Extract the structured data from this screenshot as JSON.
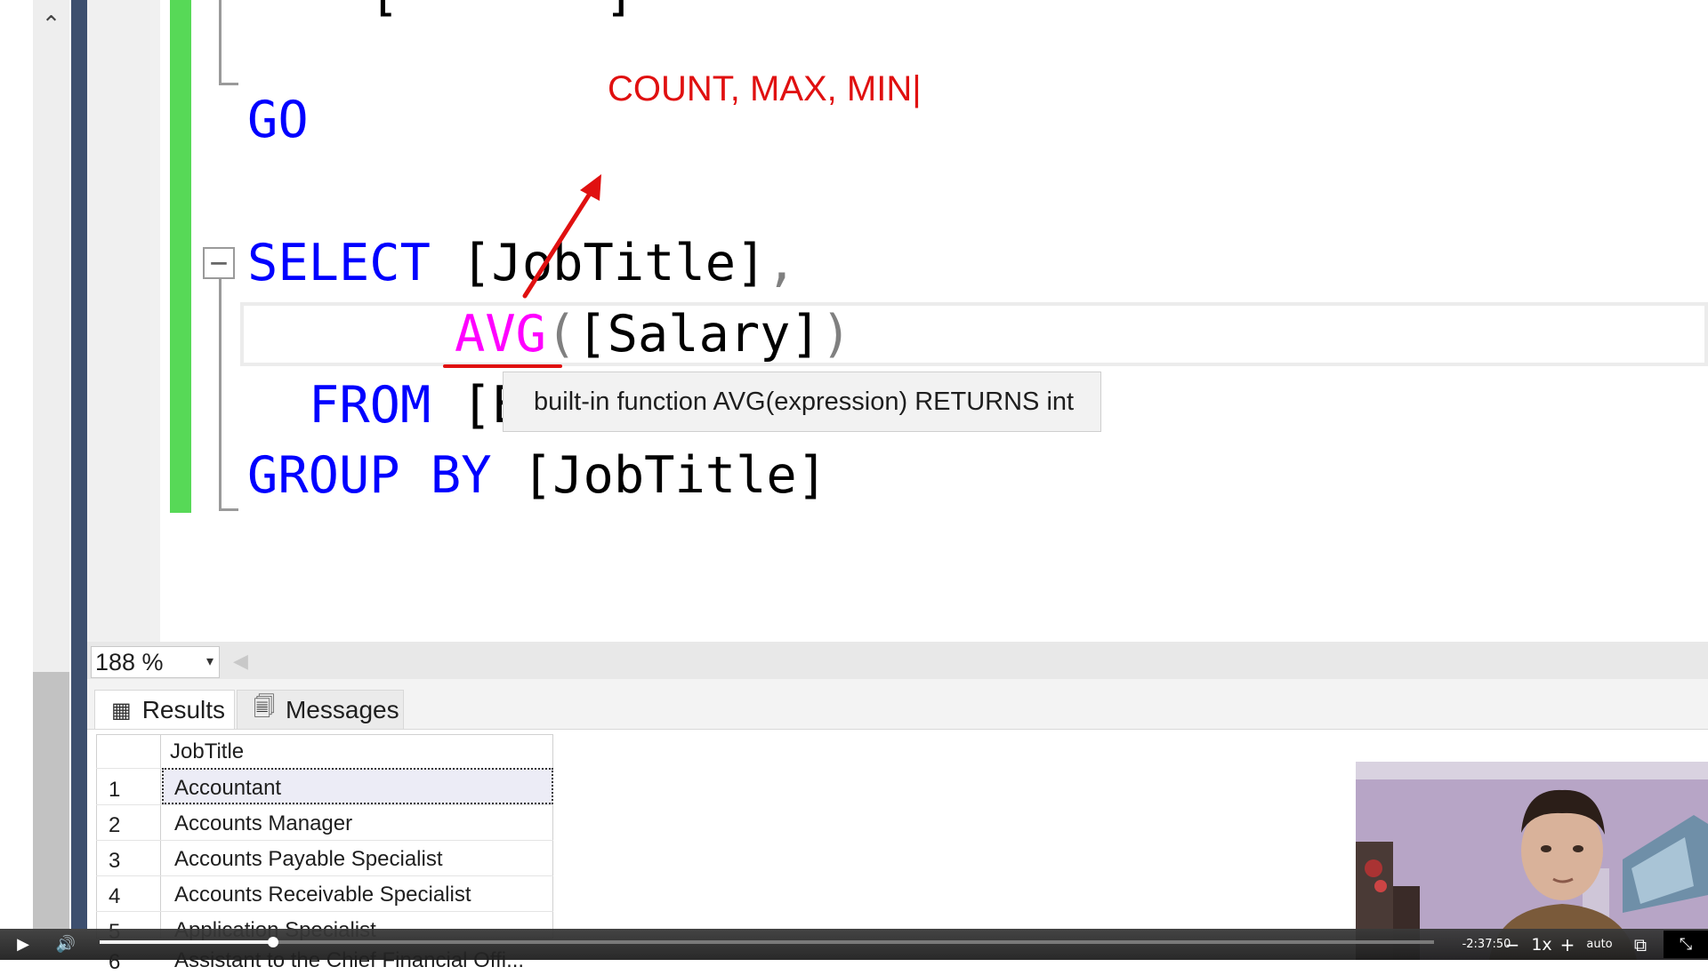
{
  "editor": {
    "line_go": "GO",
    "line_select_kw": "SELECT",
    "line_select_col": "[JobTitle]",
    "line_select_comma": ",",
    "line_avg_fn": "AVG",
    "line_avg_open": "(",
    "line_avg_arg": "[Salary]",
    "line_avg_close": ")",
    "line_from_kw": "FROM",
    "line_from_partial": "[E",
    "line_group_kw": "GROUP BY",
    "line_group_col": "[JobTitle]",
    "fold_symbol": "−",
    "top_partial_open": "[",
    "top_partial_close": "]"
  },
  "annotation": {
    "text": "COUNT, MAX, MIN|",
    "color": "#e01010"
  },
  "tooltip": {
    "text": "built-in function AVG(expression) RETURNS int"
  },
  "zoom": {
    "value": "188 %",
    "arrow": "▾"
  },
  "scroll": {
    "up_icon": "chevron-up-icon",
    "up_glyph": "⌃",
    "left_glyph": "◀"
  },
  "results": {
    "tabs": [
      {
        "label": "Results",
        "icon": "grid-icon",
        "glyph": "▦"
      },
      {
        "label": "Messages",
        "icon": "messages-icon",
        "glyph": "🗐"
      }
    ],
    "column_header": "JobTitle",
    "rows": [
      {
        "num": "1",
        "value": "Accountant"
      },
      {
        "num": "2",
        "value": "Accounts Manager"
      },
      {
        "num": "3",
        "value": "Accounts Payable Specialist"
      },
      {
        "num": "4",
        "value": "Accounts Receivable Specialist"
      },
      {
        "num": "5",
        "value": "Application Specialist"
      },
      {
        "num": "6",
        "value": "Assistant to the Chief Financial Offi..."
      }
    ]
  },
  "player": {
    "time_remaining": "-2:37:50",
    "speed": "1x",
    "quality": "auto",
    "minus": "−",
    "plus": "+",
    "play_glyph": "▶",
    "volume_glyph": "🔊",
    "pip_glyph": "⧉",
    "fullscreen_glyph": "⤡",
    "progress": 0.13
  },
  "colors": {
    "keyword": "#0000ff",
    "function": "#ff00ff",
    "change_bar": "#57d957",
    "annotation": "#e01010"
  }
}
